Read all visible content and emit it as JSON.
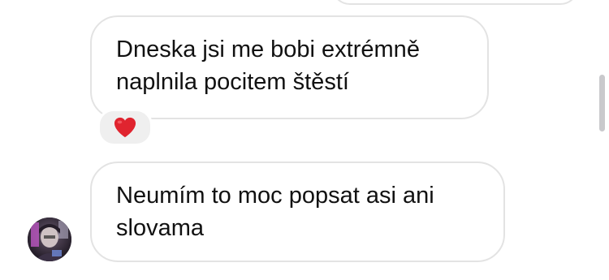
{
  "conversation": {
    "messages": [
      {
        "lines": [
          "Dneska jsi me bobi extrémně",
          "naplnila pocitem štěstí"
        ],
        "reaction": {
          "icon": "red-heart-icon"
        }
      },
      {
        "lines": [
          "Neumím to moc popsat asi ani",
          "slovama"
        ]
      }
    ],
    "sender_avatar": {
      "icon": "user-avatar"
    }
  },
  "colors": {
    "bubble_border": "#e3e3e3",
    "text": "#111111",
    "reaction_bg": "#efefef",
    "heart": "#e0242f"
  }
}
